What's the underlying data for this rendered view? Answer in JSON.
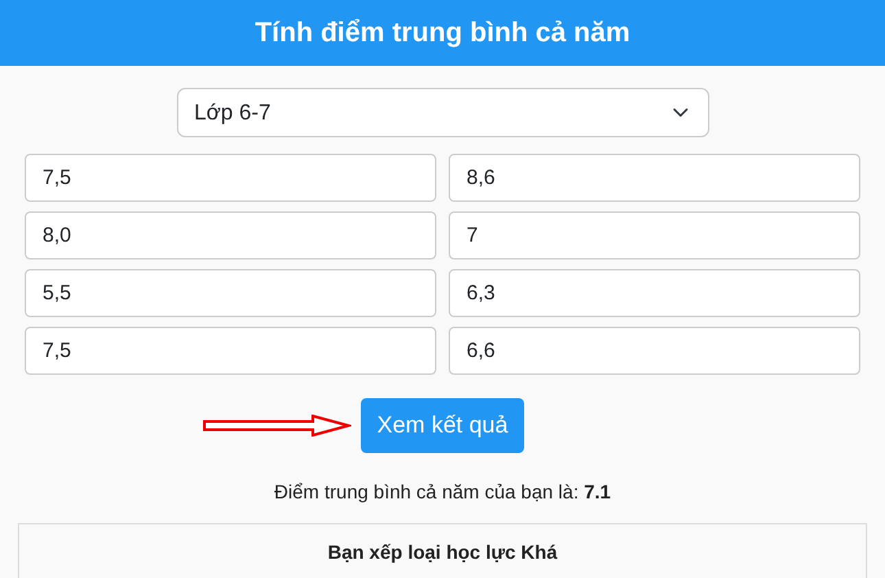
{
  "header": {
    "title": "Tính điểm trung bình cả năm"
  },
  "grade_select": {
    "value": "Lớp 6-7"
  },
  "scores": [
    {
      "value": "7,5"
    },
    {
      "value": "8,6"
    },
    {
      "value": "8,0"
    },
    {
      "value": "7"
    },
    {
      "value": "5,5"
    },
    {
      "value": "6,3"
    },
    {
      "value": "7,5"
    },
    {
      "value": "6,6"
    }
  ],
  "submit_button": {
    "label": "Xem kết quả"
  },
  "result": {
    "text": "Điểm trung bình cả năm của bạn là: **7.1**"
  },
  "classification": {
    "text": "Bạn xếp loại học lực Khá"
  }
}
